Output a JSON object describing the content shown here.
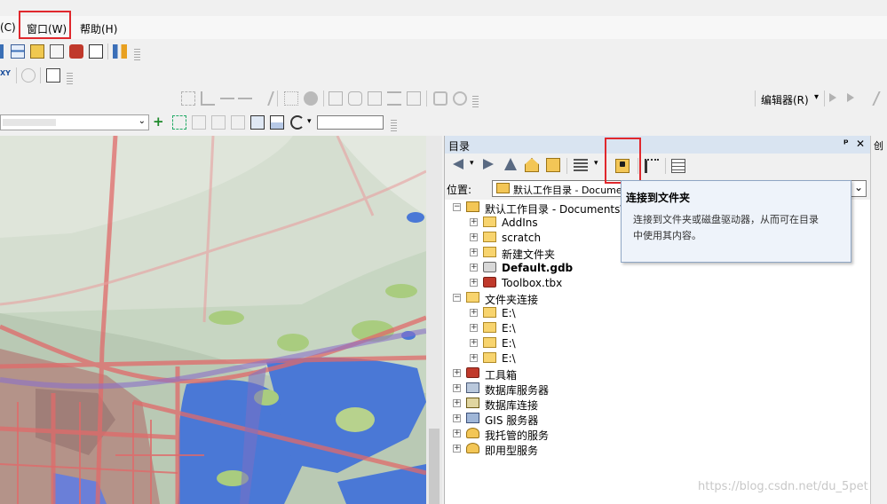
{
  "menubar": {
    "items": [
      "(C)",
      "窗口(W)",
      "帮助(H)"
    ]
  },
  "toolbar": {
    "editor_label": "编辑器(R)",
    "editor_arrow": "▾",
    "scale_value": ""
  },
  "catalog": {
    "title": "目录",
    "pin": "ᵖ",
    "close": "✕",
    "location_label": "位置:",
    "location_value": "默认工作目录 - Documents\\ArcGIS",
    "tree": [
      {
        "label": "默认工作目录 - Documents\\ArcGIS",
        "level": 0,
        "expander": "⊟",
        "icon": "home-folder-icon"
      },
      {
        "label": "AddIns",
        "level": 1,
        "expander": "⊞",
        "icon": "folder-icon"
      },
      {
        "label": "scratch",
        "level": 1,
        "expander": "⊞",
        "icon": "folder-icon"
      },
      {
        "label": "新建文件夹",
        "level": 1,
        "expander": "⊞",
        "icon": "folder-icon"
      },
      {
        "label": "Default.gdb",
        "level": 1,
        "expander": "⊞",
        "icon": "geodatabase-icon",
        "bold": true
      },
      {
        "label": "Toolbox.tbx",
        "level": 1,
        "expander": "⊞",
        "icon": "toolbox-icon"
      },
      {
        "label": "文件夹连接",
        "level": 0,
        "expander": "⊟",
        "icon": "folder-connections-icon"
      },
      {
        "label": "E:\\",
        "level": 1,
        "expander": "⊞",
        "icon": "folder-icon"
      },
      {
        "label": "E:\\",
        "level": 1,
        "expander": "⊞",
        "icon": "folder-icon"
      },
      {
        "label": "E:\\",
        "level": 1,
        "expander": "⊞",
        "icon": "folder-icon"
      },
      {
        "label": "E:\\",
        "level": 1,
        "expander": "⊞",
        "icon": "folder-icon"
      },
      {
        "label": "工具箱",
        "level": 0,
        "expander": "⊞",
        "icon": "toolbox-icon"
      },
      {
        "label": "数据库服务器",
        "level": 0,
        "expander": "⊞",
        "icon": "db-server-icon"
      },
      {
        "label": "数据库连接",
        "level": 0,
        "expander": "⊞",
        "icon": "db-connection-icon"
      },
      {
        "label": "GIS 服务器",
        "level": 0,
        "expander": "⊞",
        "icon": "gis-server-icon"
      },
      {
        "label": "我托管的服务",
        "level": 0,
        "expander": "⊞",
        "icon": "hosted-services-icon"
      },
      {
        "label": "即用型服务",
        "level": 0,
        "expander": "⊞",
        "icon": "ready-services-icon"
      }
    ]
  },
  "tooltip": {
    "title": "连接到文件夹",
    "body_line1": "连接到文件夹或磁盘驱动器，从而可在目录",
    "body_line2": "中使用其内容。"
  },
  "side_panel": {
    "label": "创"
  },
  "watermark": "https://blog.csdn.net/du_5pet",
  "colors": {
    "highlight_box": "#e0282d",
    "title_bar": "#d9e4f1",
    "tooltip_bg": "#eef3fa"
  }
}
